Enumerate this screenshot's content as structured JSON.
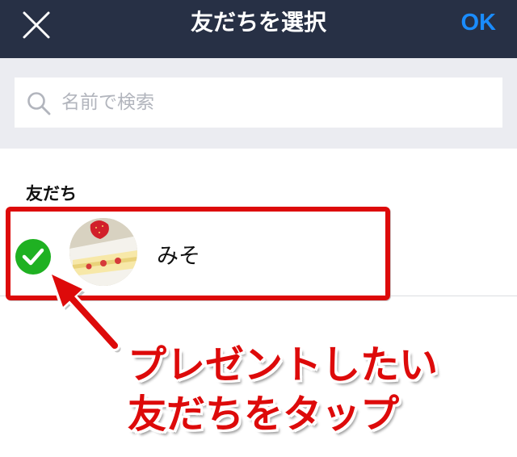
{
  "header": {
    "title": "友だちを選択",
    "ok_label": "OK",
    "close_icon": "close-icon"
  },
  "search": {
    "placeholder": "名前で検索",
    "icon": "search-icon"
  },
  "friends": {
    "section_label": "友だち",
    "items": [
      {
        "name": "みそ",
        "selected": true
      }
    ]
  },
  "annotation": {
    "line1": "プレゼントしたい",
    "line2": "友だちをタップ"
  },
  "colors": {
    "header_bg": "#273045",
    "accent": "#1a8cff",
    "check_green": "#1fb122",
    "annotation_red": "#dd0a0a",
    "search_area_bg": "#ebecf1"
  }
}
